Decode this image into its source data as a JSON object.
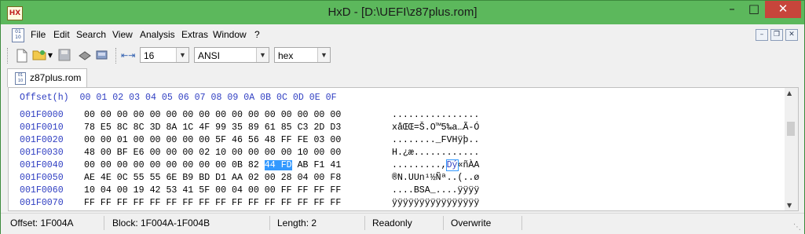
{
  "window": {
    "title": "HxD - [D:\\UEFI\\z87plus.rom]",
    "app_icon": "hxd-app-icon"
  },
  "menu": {
    "items": [
      "File",
      "Edit",
      "Search",
      "View",
      "Analysis",
      "Extras",
      "Window",
      "?"
    ]
  },
  "toolbar": {
    "bytes_per_row": "16",
    "charset": "ANSI",
    "offset_base": "hex"
  },
  "tab": {
    "label": "z87plus.rom"
  },
  "hexview": {
    "header_label": "Offset(h)",
    "columns": [
      "00",
      "01",
      "02",
      "03",
      "04",
      "05",
      "06",
      "07",
      "08",
      "09",
      "0A",
      "0B",
      "0C",
      "0D",
      "0E",
      "0F"
    ],
    "rows": [
      {
        "offset": "001F0000",
        "bytes": [
          "00",
          "00",
          "00",
          "00",
          "00",
          "00",
          "00",
          "00",
          "00",
          "00",
          "00",
          "00",
          "00",
          "00",
          "00",
          "00"
        ],
        "text": "................"
      },
      {
        "offset": "001F0010",
        "bytes": [
          "78",
          "E5",
          "8C",
          "8C",
          "3D",
          "8A",
          "1C",
          "4F",
          "99",
          "35",
          "89",
          "61",
          "85",
          "C3",
          "2D",
          "D3"
        ],
        "text": "xåŒŒ=Š.O™5‰a…Ã-Ó"
      },
      {
        "offset": "001F0020",
        "bytes": [
          "00",
          "00",
          "01",
          "00",
          "00",
          "00",
          "00",
          "00",
          "5F",
          "46",
          "56",
          "48",
          "FF",
          "FE",
          "03",
          "00"
        ],
        "text": "........_FVHÿþ.."
      },
      {
        "offset": "001F0030",
        "bytes": [
          "48",
          "00",
          "BF",
          "E6",
          "00",
          "00",
          "00",
          "02",
          "10",
          "00",
          "00",
          "00",
          "00",
          "10",
          "00",
          "00"
        ],
        "text": "H.¿æ............"
      },
      {
        "offset": "001F0040",
        "bytes": [
          "00",
          "00",
          "00",
          "00",
          "00",
          "00",
          "00",
          "00",
          "00",
          "0B",
          "82",
          "44",
          "FD",
          "AB",
          "F1",
          "C0"
        ],
        "bytes_alt": "41",
        "text_pre": ".........,",
        "text_sel": "Dý",
        "text_post": "«ñÀA"
      },
      {
        "offset": "001F0050",
        "bytes": [
          "AE",
          "4E",
          "0C",
          "55",
          "55",
          "6E",
          "B9",
          "BD",
          "D1",
          "AA",
          "02",
          "00",
          "28",
          "04",
          "00",
          "F8"
        ],
        "text": "®N.UUn¹½Ñª..(..ø"
      },
      {
        "offset": "001F0060",
        "bytes": [
          "10",
          "04",
          "00",
          "19",
          "42",
          "53",
          "41",
          "5F",
          "00",
          "04",
          "00",
          "00",
          "FF",
          "FF",
          "FF",
          "FF"
        ],
        "text": "....BSA_....ÿÿÿÿ"
      },
      {
        "offset": "001F0070",
        "bytes": [
          "FF",
          "FF",
          "FF",
          "FF",
          "FF",
          "FF",
          "FF",
          "FF",
          "FF",
          "FF",
          "FF",
          "FF",
          "FF",
          "FF",
          "FF",
          "FF"
        ],
        "text": "ÿÿÿÿÿÿÿÿÿÿÿÿÿÿÿÿ"
      }
    ]
  },
  "status": {
    "offset": "Offset: 1F004A",
    "block": "Block: 1F004A-1F004B",
    "length": "Length: 2",
    "mode": "Readonly",
    "insert": "Overwrite"
  }
}
